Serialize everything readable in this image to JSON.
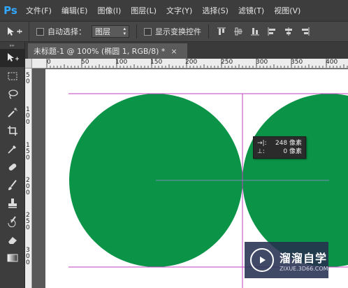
{
  "app": {
    "logo": "Ps",
    "brand_color": "#31a8ff"
  },
  "menu": [
    "文件(F)",
    "编辑(E)",
    "图像(I)",
    "图层(L)",
    "文字(Y)",
    "选择(S)",
    "滤镜(T)",
    "视图(V)"
  ],
  "options": {
    "auto_select_label": "自动选择：",
    "auto_select_value": "图层",
    "show_transform_label": "显示变换控件",
    "align_icons": [
      "align-top-icon",
      "align-vcenter-icon",
      "align-bottom-icon",
      "align-left-icon",
      "align-hcenter-icon",
      "align-right-icon"
    ]
  },
  "document": {
    "tab_title": "未标题-1 @ 100% (椭圆 1, RGB/8) *",
    "close_glyph": "×"
  },
  "rulers": {
    "h_labels": [
      "0",
      "50",
      "100",
      "150",
      "200",
      "250",
      "300",
      "350",
      "400"
    ],
    "v_labels": [
      "5\n0",
      "1\n0\n0",
      "1\n5\n0",
      "2\n0\n0",
      "2\n5\n0",
      "3\n0\n0"
    ]
  },
  "tools": [
    "move-tool-icon",
    "marquee-tool-icon",
    "lasso-tool-icon",
    "magic-wand-icon",
    "crop-tool-icon",
    "eyedropper-icon",
    "healing-brush-icon",
    "brush-tool-icon",
    "stamp-tool-icon",
    "history-brush-icon",
    "eraser-tool-icon",
    "gradient-tool-icon"
  ],
  "canvas": {
    "shape_color": "#0b9447",
    "guide_color": "#c040c0",
    "measure_line_color": "#7a8ab4"
  },
  "measure_tooltip": {
    "row1_icon": "→|:",
    "row1_value": "248 像素",
    "row2_icon": "⊥:",
    "row2_value": "0 像素"
  },
  "watermark": {
    "title": "溜溜自学",
    "url": "ZIXUE.3D66.COM"
  }
}
